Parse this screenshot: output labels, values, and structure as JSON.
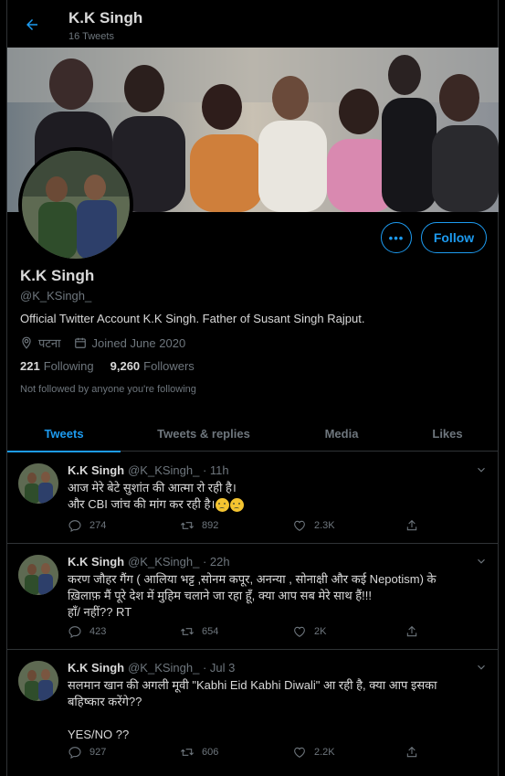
{
  "header": {
    "name": "K.K Singh",
    "tweet_count": "16 Tweets"
  },
  "profile": {
    "name": "K.K Singh",
    "handle": "@K_KSingh_",
    "bio": "Official Twitter Account K.K Singh. Father of Susant Singh Rajput.",
    "location": "पटना",
    "joined": "Joined June 2020",
    "following_count": "221",
    "following_label": "Following",
    "followers_count": "9,260",
    "followers_label": "Followers",
    "not_followed": "Not followed by anyone you're following",
    "more_label": "•••",
    "follow_label": "Follow"
  },
  "tabs": [
    {
      "label": "Tweets",
      "active": true
    },
    {
      "label": "Tweets & replies",
      "active": false
    },
    {
      "label": "Media",
      "active": false
    },
    {
      "label": "Likes",
      "active": false
    }
  ],
  "tweets": [
    {
      "name": "K.K Singh",
      "meta": "@K_KSingh_ · 11h",
      "lines": [
        "आज मेरे बेटे सुशांत की आत्मा रो रही है।",
        "और CBI जांच की मांग कर रही है।"
      ],
      "replies": "274",
      "retweets": "892",
      "likes": "2.3K"
    },
    {
      "name": "K.K Singh",
      "meta": "@K_KSingh_ · 22h",
      "lines": [
        "करण जौहर गैंग ( आलिया भट्ट ,सोनम कपूर, अनन्या , सोनाक्षी  और कई Nepotism) के",
        "ख़िलाफ़ मैं पूरे देश में मुहिम चलाने जा रहा हूँ, क्या आप सब मेरे साथ हैं!!!",
        "हाँ/ नहीं?? RT"
      ],
      "replies": "423",
      "retweets": "654",
      "likes": "2K"
    },
    {
      "name": "K.K Singh",
      "meta": "@K_KSingh_ · Jul 3",
      "lines": [
        "सलमान खान  की अगली मूवी \"Kabhi Eid Kabhi Diwali\" आ रही है, क्या आप इसका",
        "बहिष्कार करेंगे??",
        "",
        "YES/NO ??"
      ],
      "replies": "927",
      "retweets": "606",
      "likes": "2.2K"
    }
  ],
  "colors": {
    "accent": "#1d9bf0",
    "background": "#000000",
    "muted": "#6e767d",
    "text": "#d9d9d9"
  }
}
